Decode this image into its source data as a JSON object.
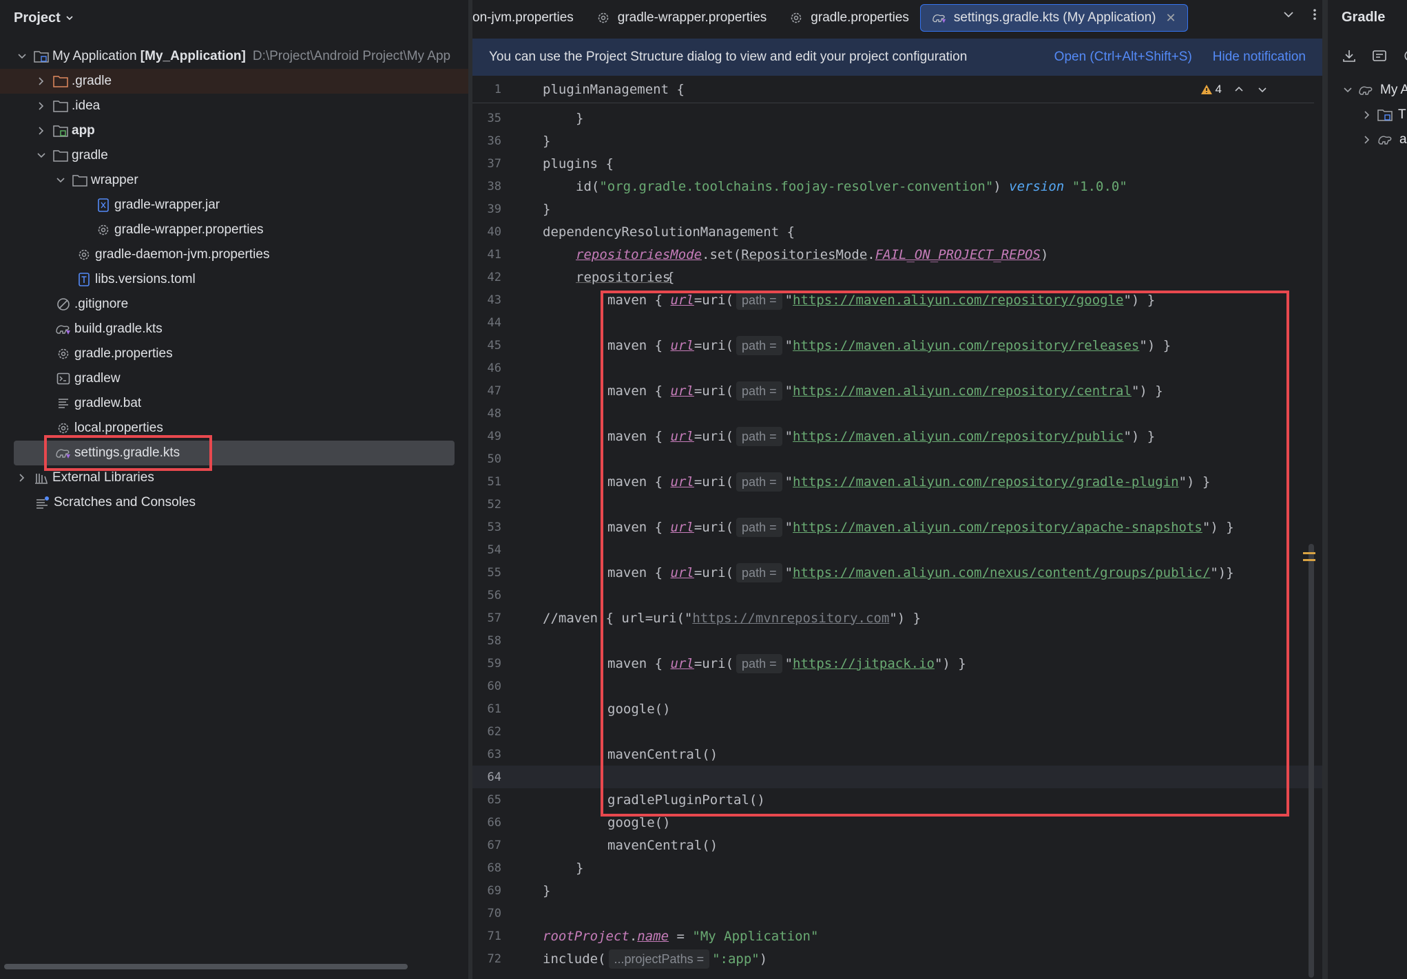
{
  "project_panel": {
    "title": "Project",
    "tree": [
      {
        "label": "My Application",
        "bold_suffix": "[My_Application]",
        "path": "D:\\Project\\Android Project\\My App"
      },
      {
        "label": ".gradle"
      },
      {
        "label": ".idea"
      },
      {
        "label": "app"
      },
      {
        "label": "gradle"
      },
      {
        "label": "wrapper"
      },
      {
        "label": "gradle-wrapper.jar"
      },
      {
        "label": "gradle-wrapper.properties"
      },
      {
        "label": "gradle-daemon-jvm.properties"
      },
      {
        "label": "libs.versions.toml"
      },
      {
        "label": ".gitignore"
      },
      {
        "label": "build.gradle.kts"
      },
      {
        "label": "gradle.properties"
      },
      {
        "label": "gradlew"
      },
      {
        "label": "gradlew.bat"
      },
      {
        "label": "local.properties"
      },
      {
        "label": "settings.gradle.kts"
      },
      {
        "label": "External Libraries"
      },
      {
        "label": "Scratches and Consoles"
      }
    ]
  },
  "tabs": [
    {
      "label": "on-jvm.properties"
    },
    {
      "label": "gradle-wrapper.properties"
    },
    {
      "label": "gradle.properties"
    },
    {
      "label": "settings.gradle.kts (My Application)"
    }
  ],
  "notification": {
    "text": "You can use the Project Structure dialog to view and edit your project configuration",
    "open_link": "Open (Ctrl+Alt+Shift+S)",
    "hide_link": "Hide notification"
  },
  "editor": {
    "warnings_count": "4",
    "sticky_line": {
      "num": "1",
      "text": "pluginManagement {"
    },
    "line_numbers": [
      "35",
      "36",
      "37",
      "38",
      "39",
      "40",
      "41",
      "42",
      "43",
      "44",
      "45",
      "46",
      "47",
      "48",
      "49",
      "50",
      "51",
      "52",
      "53",
      "54",
      "55",
      "56",
      "57",
      "58",
      "59",
      "60",
      "61",
      "62",
      "63",
      "64",
      "65",
      "66",
      "67",
      "68",
      "69",
      "70",
      "71",
      "72"
    ],
    "hint_path": "path =",
    "hint_project_paths": "...projectPaths =",
    "plugin_id": "\"org.gradle.toolchains.foojay-resolver-convention\"",
    "plugin_version": "\"1.0.0\"",
    "repo_mode_prop": "repositoriesMode",
    "repo_mode_class": "RepositoriesMode",
    "repo_mode_const": "FAIL_ON_PROJECT_REPOS",
    "urls": [
      "https://maven.aliyun.com/repository/google",
      "https://maven.aliyun.com/repository/releases",
      "https://maven.aliyun.com/repository/central",
      "https://maven.aliyun.com/repository/public",
      "https://maven.aliyun.com/repository/gradle-plugin",
      "https://maven.aliyun.com/repository/apache-snapshots",
      "https://maven.aliyun.com/nexus/content/groups/public/"
    ],
    "commented_url": "https://mvnrepository.com",
    "jitpack_url": "https://jitpack.io",
    "root_name_value": "\"My Application\"",
    "include_value": "\":app\""
  },
  "gradle_panel": {
    "title": "Gradle",
    "items": [
      "My A",
      "T",
      "a"
    ]
  },
  "colors": {
    "highlight_box": "#e8484e",
    "accent": "#3574f0"
  }
}
